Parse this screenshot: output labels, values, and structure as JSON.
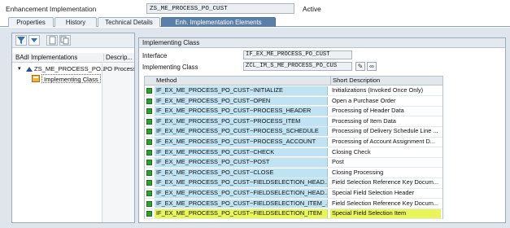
{
  "header": {
    "label": "Enhancement Implementation",
    "value": "ZS_ME_PROCESS_PO_CUST",
    "status": "Active"
  },
  "tabs": [
    {
      "label": "Properties",
      "active": false
    },
    {
      "label": "History",
      "active": false
    },
    {
      "label": "Technical Details",
      "active": false
    },
    {
      "label": "Enh. Implementation Elements",
      "active": true
    }
  ],
  "left_panel": {
    "toolbar_icons": [
      "filter-icon",
      "collapse-icon",
      "new-icon",
      "copy-icon"
    ],
    "columns": [
      "BAdI Implementations",
      "Descrip..."
    ],
    "tree": [
      {
        "label": "ZS_ME_PROCESS_PO...",
        "description": "PO Process"
      },
      {
        "label": "Implementing Class",
        "description": ""
      }
    ]
  },
  "right_panel": {
    "title": "Implementing Class",
    "interface_label": "Interface",
    "interface_value": "IF_EX_ME_PROCESS_PO_CUST",
    "class_label": "Implementing Class",
    "class_value": "ZCL_IM_S_ME_PROCESS_PO_CUS",
    "table": {
      "columns": [
        "Method",
        "Short Description"
      ],
      "rows": [
        {
          "method": "IF_EX_ME_PROCESS_PO_CUST~INITIALIZE",
          "desc": "Initializations (Invoked Once Only)"
        },
        {
          "method": "IF_EX_ME_PROCESS_PO_CUST~OPEN",
          "desc": "Open a Purchase Order"
        },
        {
          "method": "IF_EX_ME_PROCESS_PO_CUST~PROCESS_HEADER",
          "desc": "Processing of Header Data"
        },
        {
          "method": "IF_EX_ME_PROCESS_PO_CUST~PROCESS_ITEM",
          "desc": "Processing of Item Data"
        },
        {
          "method": "IF_EX_ME_PROCESS_PO_CUST~PROCESS_SCHEDULE",
          "desc": "Processing of Delivery Schedule Line ..."
        },
        {
          "method": "IF_EX_ME_PROCESS_PO_CUST~PROCESS_ACCOUNT",
          "desc": "Processing of Account Assignment D..."
        },
        {
          "method": "IF_EX_ME_PROCESS_PO_CUST~CHECK",
          "desc": "Closing Check"
        },
        {
          "method": "IF_EX_ME_PROCESS_PO_CUST~POST",
          "desc": "Post"
        },
        {
          "method": "IF_EX_ME_PROCESS_PO_CUST~CLOSE",
          "desc": "Closing Processing"
        },
        {
          "method": "IF_EX_ME_PROCESS_PO_CUST~FIELDSELECTION_HEAD...",
          "desc": "Field Selection Reference Key Docum..."
        },
        {
          "method": "IF_EX_ME_PROCESS_PO_CUST~FIELDSELECTION_HEAD...",
          "desc": "Special Field Selection Header"
        },
        {
          "method": "IF_EX_ME_PROCESS_PO_CUST~FIELDSELECTION_ITEM_...",
          "desc": "Field Selection Reference Key Docum..."
        },
        {
          "method": "IF_EX_ME_PROCESS_PO_CUST~FIELDSELECTION_ITEM",
          "desc": "Special Field Selection Item",
          "highlighted": true
        }
      ]
    }
  },
  "colors": {
    "method_cell": "#bfe3f2",
    "highlight": "#e8f65a",
    "status_led": "#29a329",
    "active_tab": "#5a7fa8"
  }
}
